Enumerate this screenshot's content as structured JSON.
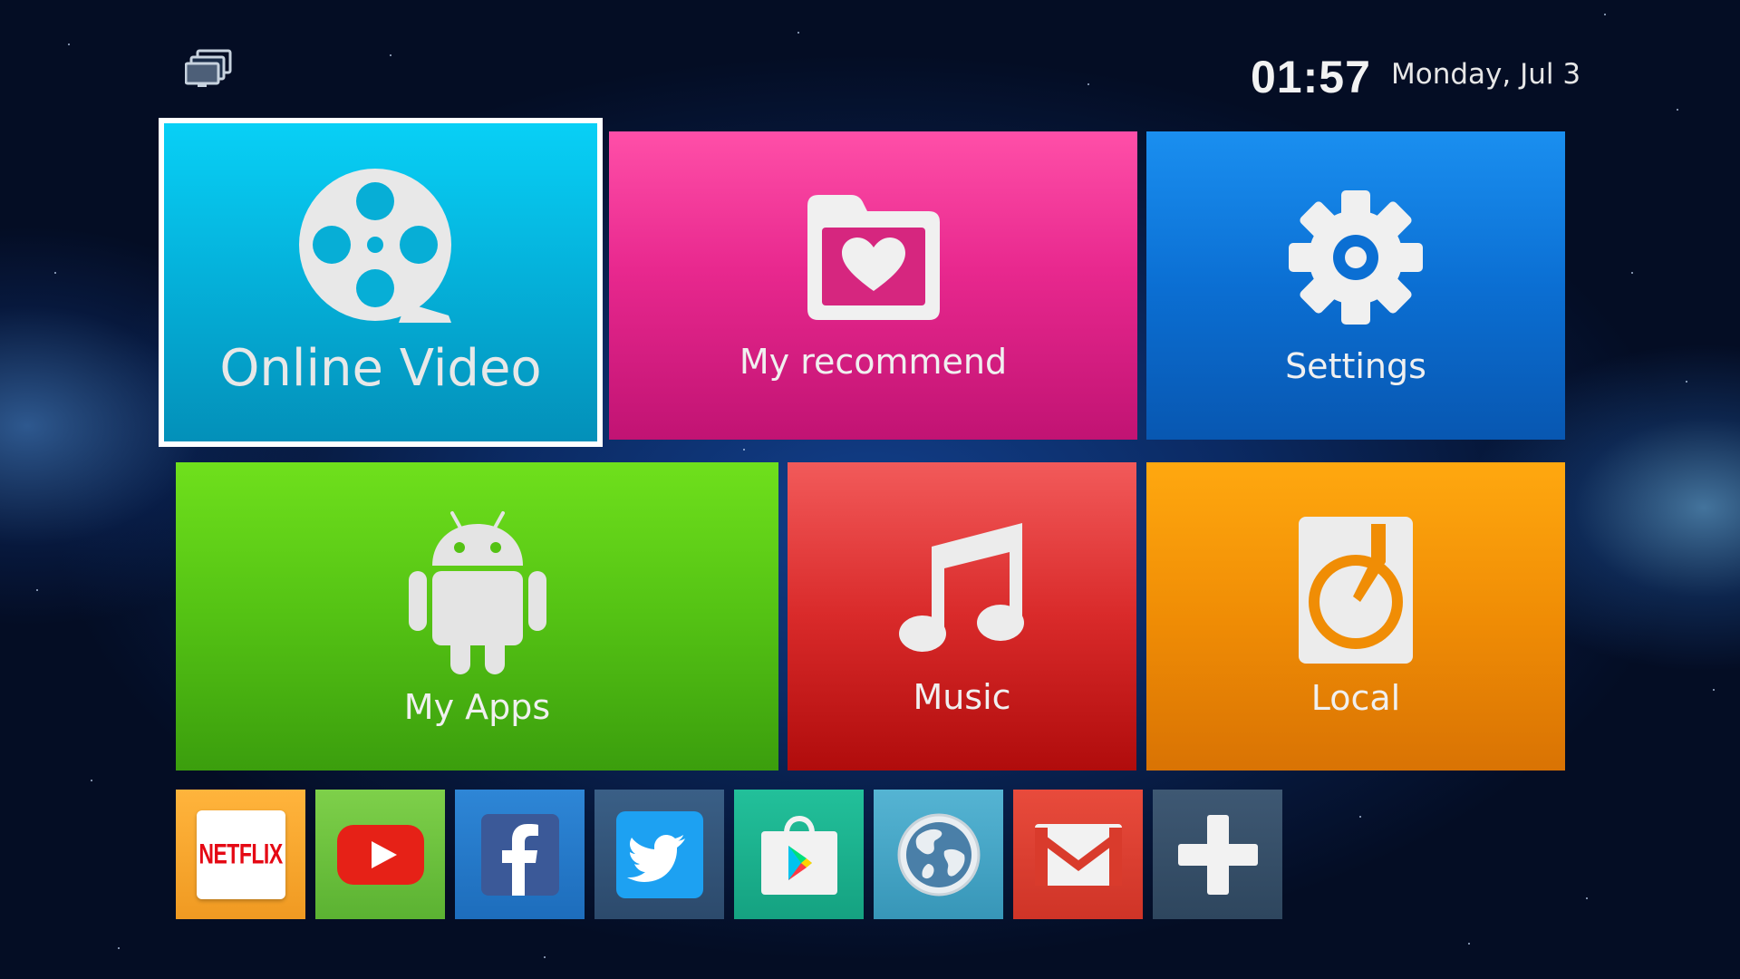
{
  "topbar": {
    "icon": "multi-screen-icon",
    "time": "01:57",
    "date": "Monday, Jul 3"
  },
  "tiles": {
    "online_video": {
      "label": "Online Video",
      "icon": "film-reel-icon",
      "color": "#05b3dc",
      "focused": true
    },
    "my_recommend": {
      "label": "My recommend",
      "icon": "heart-folder-icon",
      "color": "#e8288e"
    },
    "settings": {
      "label": "Settings",
      "icon": "gear-icon",
      "color": "#0b6fd3"
    },
    "my_apps": {
      "label": "My Apps",
      "icon": "android-icon",
      "color": "#54c214"
    },
    "music": {
      "label": "Music",
      "icon": "music-note-icon",
      "color": "#d92a2a"
    },
    "local": {
      "label": "Local",
      "icon": "disk-drive-icon",
      "color": "#f08d05"
    }
  },
  "dock": [
    {
      "name": "netflix",
      "text": "NETFLIX",
      "icon": "netflix-icon"
    },
    {
      "name": "youtube",
      "icon": "youtube-icon"
    },
    {
      "name": "facebook",
      "icon": "facebook-icon"
    },
    {
      "name": "twitter",
      "icon": "twitter-icon"
    },
    {
      "name": "play-store",
      "icon": "play-store-icon"
    },
    {
      "name": "browser",
      "icon": "globe-icon"
    },
    {
      "name": "gmail",
      "icon": "mail-icon"
    },
    {
      "name": "add",
      "icon": "plus-icon"
    }
  ]
}
